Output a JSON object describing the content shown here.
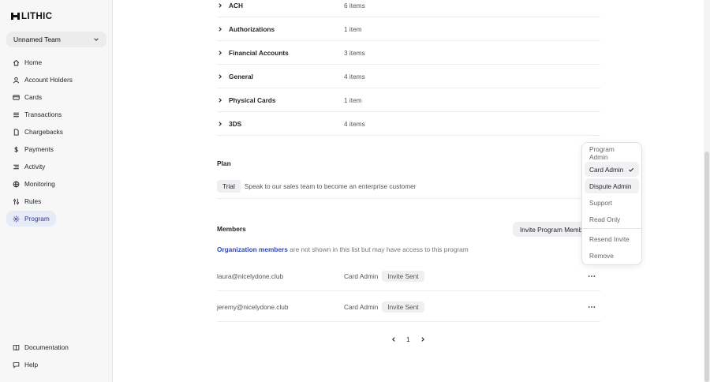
{
  "brand": {
    "name": "LITHIC"
  },
  "team": {
    "label": "Unnamed Team"
  },
  "nav": {
    "items": [
      {
        "label": "Home",
        "icon": "home-icon"
      },
      {
        "label": "Account Holders",
        "icon": "user-icon"
      },
      {
        "label": "Cards",
        "icon": "card-icon"
      },
      {
        "label": "Transactions",
        "icon": "list-icon"
      },
      {
        "label": "Chargebacks",
        "icon": "document-icon"
      },
      {
        "label": "Payments",
        "icon": "dollar-icon"
      },
      {
        "label": "Activity",
        "icon": "activity-icon"
      },
      {
        "label": "Monitoring",
        "icon": "globe-icon"
      },
      {
        "label": "Rules",
        "icon": "rules-icon"
      },
      {
        "label": "Program",
        "icon": "gear-icon"
      }
    ],
    "active": "Program",
    "bottom": [
      {
        "label": "Documentation",
        "icon": "book-icon"
      },
      {
        "label": "Help",
        "icon": "chat-icon"
      }
    ]
  },
  "permissions": [
    {
      "name": "ACH",
      "count": "6 items"
    },
    {
      "name": "Authorizations",
      "count": "1 item"
    },
    {
      "name": "Financial Accounts",
      "count": "3 items"
    },
    {
      "name": "General",
      "count": "4 items"
    },
    {
      "name": "Physical Cards",
      "count": "1 item"
    },
    {
      "name": "3DS",
      "count": "4 items"
    }
  ],
  "plan": {
    "label": "Plan",
    "tier": "Trial",
    "description": "Speak to our sales team to become an enterprise customer"
  },
  "members": {
    "label": "Members",
    "invite_button": "Invite Program Member",
    "note_link": "Organization members",
    "note_text": " are not shown in this list but may have access to this program",
    "rows": [
      {
        "email": "laura@nicelydone.club",
        "role": "Card Admin",
        "status": "Invite Sent"
      },
      {
        "email": "jeremy@nicelydone.club",
        "role": "Card Admin",
        "status": "Invite Sent"
      }
    ]
  },
  "pagination": {
    "current": "1"
  },
  "role_menu": {
    "options": [
      "Program Admin",
      "Card Admin",
      "Dispute Admin",
      "Support",
      "Read Only"
    ],
    "selected": "Card Admin",
    "actions": [
      "Resend Invite",
      "Remove"
    ]
  },
  "colors": {
    "accent": "#2f3d8f",
    "link": "#3346b8",
    "active_bg": "#e7eaf7"
  }
}
